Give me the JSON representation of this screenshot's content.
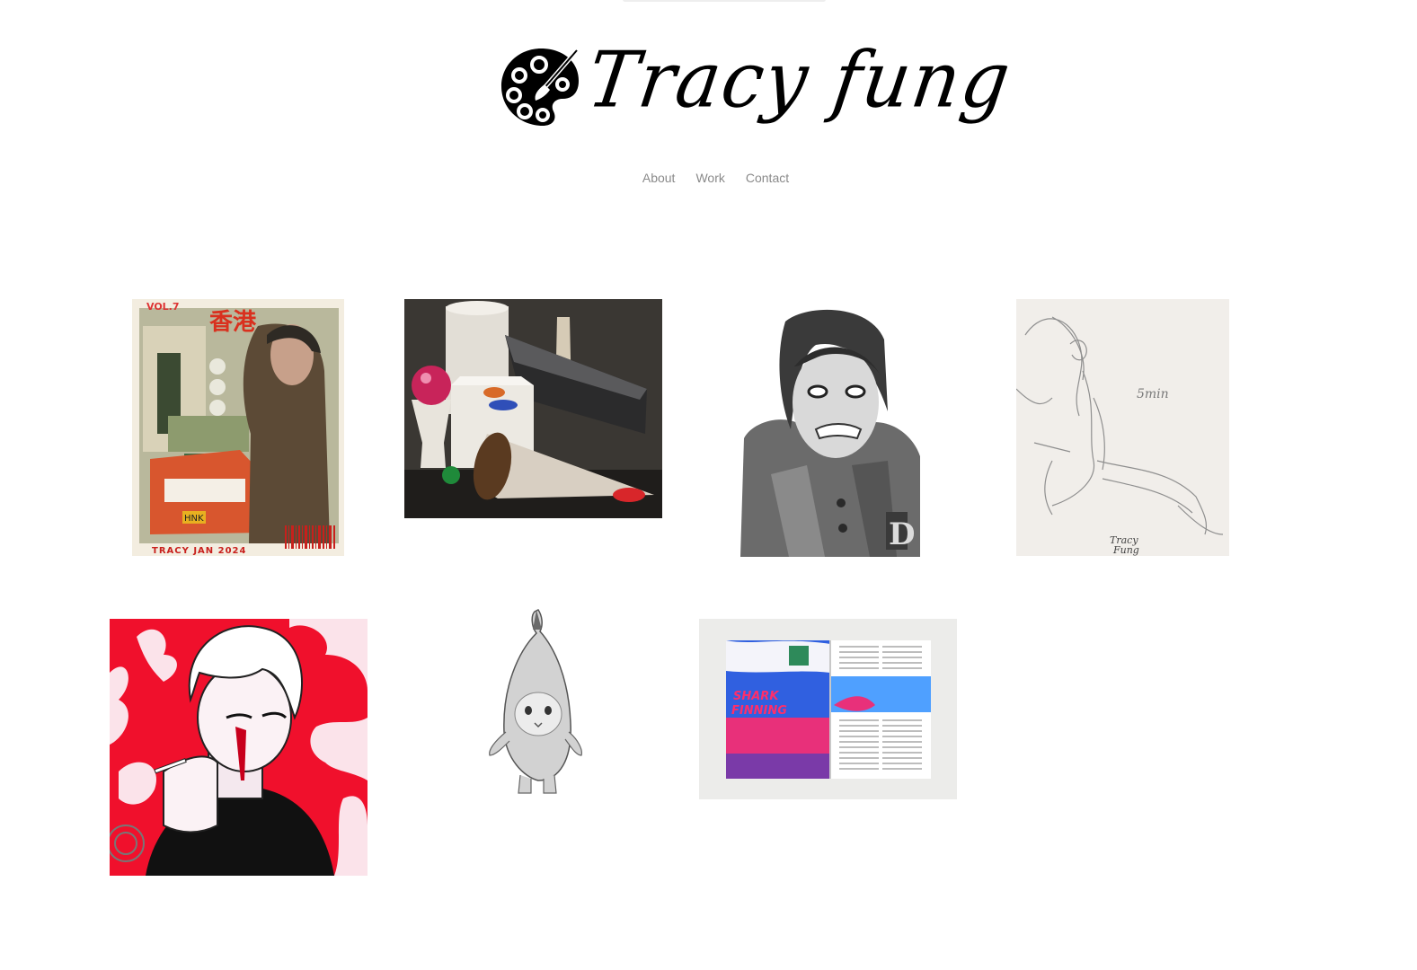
{
  "site": {
    "logo_text": "Tracy fung",
    "logo_icon": "palette-icon"
  },
  "nav": {
    "items": [
      {
        "label": "About"
      },
      {
        "label": "Work"
      },
      {
        "label": "Contact"
      }
    ]
  },
  "gallery": {
    "items": [
      {
        "name": "hong-kong-magazine-cover",
        "texts": [
          "VOL.7",
          "香港",
          "HNK",
          "TRACY JAN 2024"
        ]
      },
      {
        "name": "still-life-painting",
        "texts": []
      },
      {
        "name": "pencil-self-portrait",
        "texts": [
          "D"
        ]
      },
      {
        "name": "gesture-figure-sketch",
        "texts": [
          "5min",
          "Tracy",
          "Fung"
        ]
      },
      {
        "name": "smoking-character-illustration",
        "texts": []
      },
      {
        "name": "banana-cat-pencil-drawing",
        "texts": []
      },
      {
        "name": "shark-finning-magazine-spread",
        "texts": [
          "SHARK",
          "FINNING"
        ]
      }
    ]
  },
  "colors": {
    "nav_text": "#8a8a8a",
    "logo": "#000000",
    "accent_red": "#f0102c"
  }
}
